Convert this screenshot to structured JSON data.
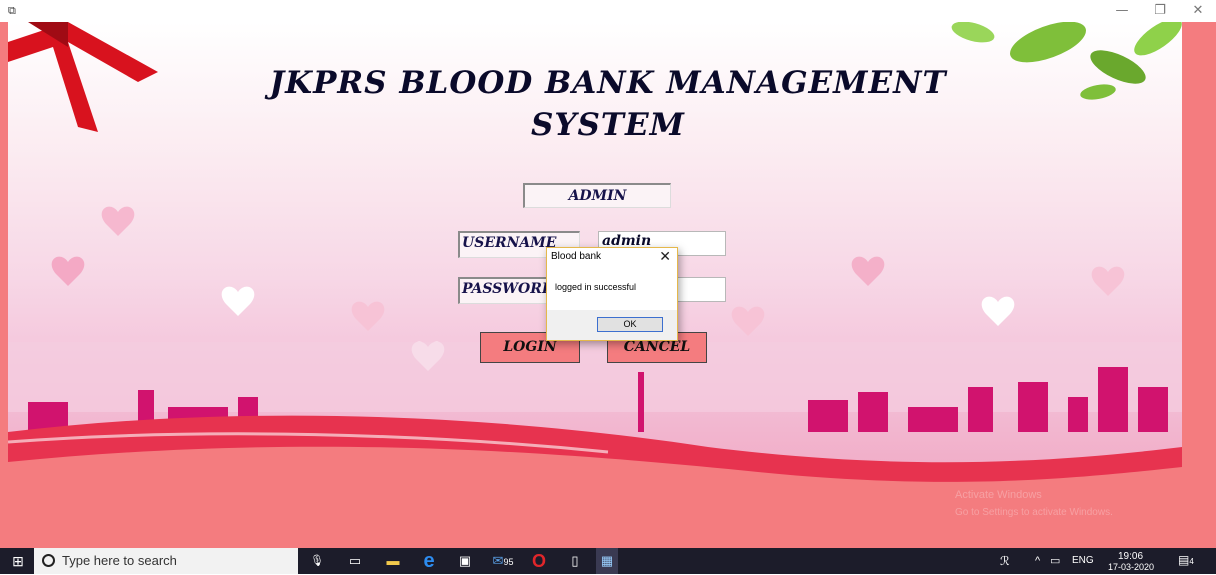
{
  "window": {
    "app_icon_glyph": "⧉",
    "minimize_glyph": "—",
    "maximize_glyph": "❐",
    "close_glyph": "✕"
  },
  "page": {
    "title_line1": "JKPRS BLOOD BANK MANAGEMENT",
    "title_line2": "SYSTEM",
    "admin_label": "ADMIN",
    "username_label": "USERNAME",
    "username_value": "admin",
    "password_label": "PASSWORD",
    "password_value": "",
    "login_button": "LOGIN",
    "cancel_button": "CANCEL"
  },
  "dialog": {
    "title": "Blood bank",
    "close_glyph": "✕",
    "message": "logged in successful",
    "ok_button": "OK"
  },
  "watermark": {
    "line1": "Activate Windows",
    "line2": "Go to Settings to activate Windows."
  },
  "taskbar": {
    "start_glyph": "⊞",
    "search_placeholder": "Type here to search",
    "mic_glyph": "🎙",
    "taskview_glyph": "▭",
    "explorer_glyph": "▬",
    "edge_glyph": "e",
    "store_glyph": "▣",
    "mail_badge": "95",
    "opera_glyph": "O",
    "notepad_glyph": "▯",
    "app_glyph": "▦",
    "people_glyph": "ℛ",
    "tray_up_glyph": "^",
    "battery_glyph": "▭",
    "language": "ENG",
    "time": "19:06",
    "date": "17-03-2020",
    "notification_count": "4"
  },
  "colors": {
    "background_pink": "#f47c7f",
    "button_fill": "#f47c7f",
    "title_text": "#0a0a2a",
    "taskbar": "#1c1c2a"
  }
}
